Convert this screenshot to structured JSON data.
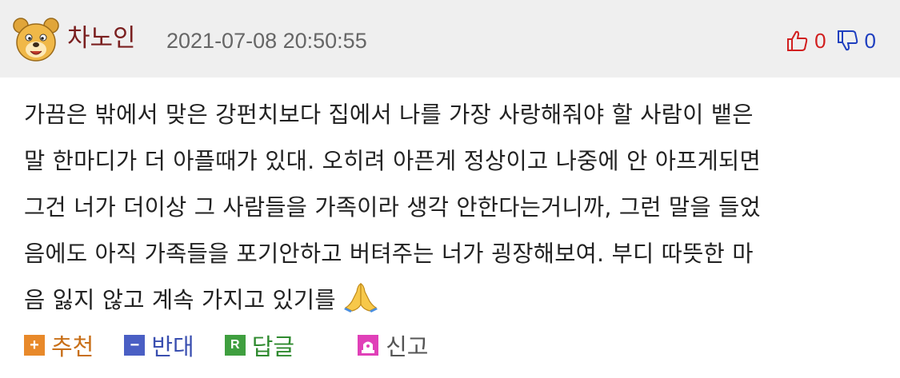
{
  "comment": {
    "author": "차노인",
    "timestamp": "2021-07-08 20:50:55",
    "upvotes": "0",
    "downvotes": "0",
    "lines": [
      "가끔은 밖에서 맞은 강펀치보다 집에서 나를 가장 사랑해줘야 할 사람이 뱉은",
      "말 한마디가 더 아플때가 있대. 오히려 아픈게 정상이고 나중에 안 아프게되면",
      "그건 너가 더이상 그 사람들을 가족이라 생각 안한다는거니까, 그런 말을 들었",
      "음에도 아직 가족들을 포기안하고 버텨주는 너가 굉장해보여. 부디 따뜻한 마",
      "음 잃지 않고 계속 가지고 있기를"
    ]
  },
  "actions": {
    "recommend": "추천",
    "oppose": "반대",
    "reply": "답글",
    "report": "신고"
  },
  "icons": {
    "avatar": "bear-avatar-icon",
    "upvote": "thumbs-up-icon",
    "downvote": "thumbs-down-icon",
    "emoji": "folded-hands-icon"
  },
  "colors": {
    "author": "#7a1f1f",
    "upvote": "#d11f1f",
    "downvote": "#1f3fbf",
    "recommend": "#e8892a",
    "oppose": "#4a5fc4",
    "reply": "#3f9f3f"
  }
}
